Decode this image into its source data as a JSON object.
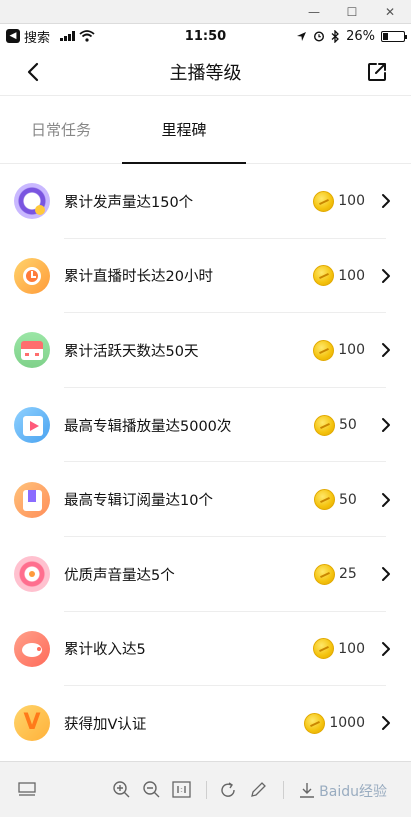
{
  "status_bar": {
    "back_app_label": "搜索",
    "time": "11:50",
    "battery": "26%",
    "battery_level": 0.26
  },
  "header": {
    "title": "主播等级"
  },
  "tabs": [
    {
      "label": "日常任务",
      "active": false
    },
    {
      "label": "里程碑",
      "active": true
    }
  ],
  "milestones": [
    {
      "title": "累计发声量达150个",
      "reward": "100",
      "icon": "voice-icon"
    },
    {
      "title": "累计直播时长达20小时",
      "reward": "100",
      "icon": "alarm-clock-icon"
    },
    {
      "title": "累计活跃天数达50天",
      "reward": "100",
      "icon": "calendar-icon"
    },
    {
      "title": "最高专辑播放量达5000次",
      "reward": "50",
      "icon": "play-album-icon"
    },
    {
      "title": "最高专辑订阅量达10个",
      "reward": "50",
      "icon": "bookmark-album-icon"
    },
    {
      "title": "优质声音量达5个",
      "reward": "25",
      "icon": "quality-sound-icon"
    },
    {
      "title": "累计收入达5",
      "reward": "100",
      "icon": "piggy-bank-icon"
    },
    {
      "title": "获得加V认证",
      "reward": "1000",
      "icon": "v-badge-icon"
    }
  ],
  "watermark": "Baidu经验",
  "colors": {
    "coin": "#f4c20d",
    "active_tab_underline": "#111111"
  }
}
